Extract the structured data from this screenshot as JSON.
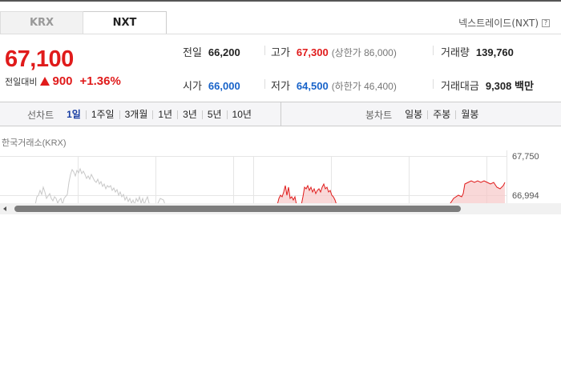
{
  "tabs": [
    {
      "label": "KRX",
      "active": false
    },
    {
      "label": "NXT",
      "active": true
    }
  ],
  "source_label": "넥스트레이드(NXT)",
  "help_glyph": "?",
  "price": {
    "current": "67,100",
    "change_label": "전일대비",
    "change_value": "900",
    "change_pct": "+1.36%",
    "direction": "up"
  },
  "stats": {
    "prev_close": {
      "label": "전일",
      "value": "66,200"
    },
    "open": {
      "label": "시가",
      "value": "66,000"
    },
    "high": {
      "label": "고가",
      "value": "67,300",
      "limit": "(상한가 86,000)"
    },
    "low": {
      "label": "저가",
      "value": "64,500",
      "limit": "(하한가 46,400)"
    },
    "volume": {
      "label": "거래량",
      "value": "139,760"
    },
    "amount": {
      "label": "거래대금",
      "value": "9,308 백만"
    }
  },
  "line_chart": {
    "title": "선차트",
    "periods": [
      "1일",
      "1주일",
      "3개월",
      "1년",
      "3년",
      "5년",
      "10년"
    ],
    "active": "1일"
  },
  "candle_chart": {
    "title": "봉차트",
    "periods": [
      "일봉",
      "주봉",
      "월봉"
    ]
  },
  "exchange_label": "한국거래소(KRX)",
  "chart_axis": {
    "top_label": "67,750",
    "mid_label": "66,994"
  },
  "colors": {
    "up": "#e01b1b",
    "down": "#1863c9",
    "active_period": "#1a3fa3"
  }
}
